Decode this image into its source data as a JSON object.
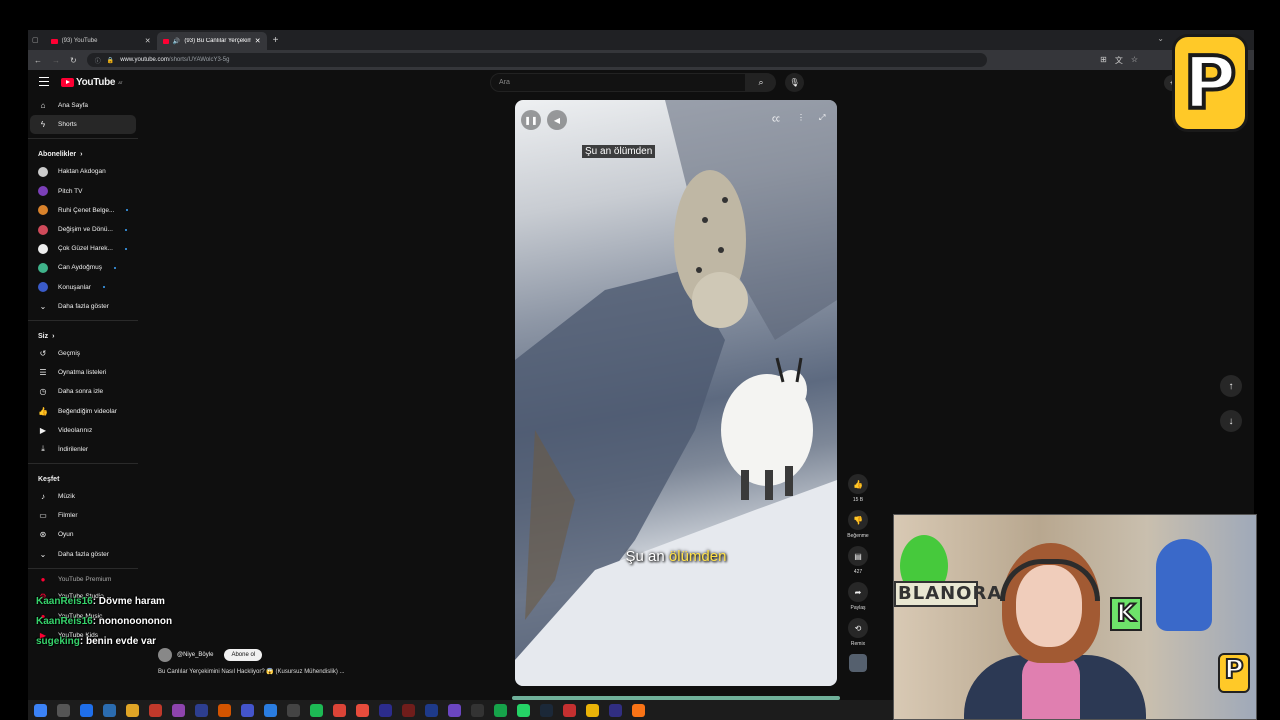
{
  "browser": {
    "tabs": [
      {
        "label": "(93) YouTube",
        "active": false
      },
      {
        "label": "(93) Bu Canlılar Yerçekimini",
        "active": true
      }
    ],
    "url": "www.youtube.com/shorts/UYAWolcY3-5g",
    "url_host": "www.youtube.com",
    "url_path": "/shorts/UYAWolcY3-5g"
  },
  "youtube": {
    "logo_text": "YouTube",
    "logo_suffix": "AT",
    "search_placeholder": "Ara",
    "create_label": "Ol"
  },
  "sidebar": {
    "main": [
      {
        "label": "Ana Sayfa",
        "icon": "home-icon"
      },
      {
        "label": "Shorts",
        "icon": "shorts-icon",
        "active": true
      }
    ],
    "subscriptions_header": "Abonelikler",
    "subscriptions": [
      {
        "label": "Haktan Akdogan",
        "color": "#cccccc",
        "dot": false
      },
      {
        "label": "Pitch TV",
        "color": "#7b3fb8",
        "dot": false
      },
      {
        "label": "Ruhi Çenet Belge...",
        "color": "#d9822b",
        "dot": true
      },
      {
        "label": "Değişim ve Dönü...",
        "color": "#d04a5a",
        "dot": true
      },
      {
        "label": "Çok Güzel Harek...",
        "color": "#eeeeee",
        "dot": true
      },
      {
        "label": "Can Aydoğmuş",
        "color": "#3fb38a",
        "dot": true
      },
      {
        "label": "Konuşanlar",
        "color": "#3a5bc9",
        "dot": true
      }
    ],
    "show_more_1": "Daha fazla göster",
    "you_header": "Siz",
    "you": [
      {
        "label": "Geçmiş",
        "icon": "history-icon"
      },
      {
        "label": "Oynatma listeleri",
        "icon": "playlist-icon"
      },
      {
        "label": "Daha sonra izle",
        "icon": "clock-icon"
      },
      {
        "label": "Beğendiğim videolar",
        "icon": "like-icon"
      },
      {
        "label": "Videolarınız",
        "icon": "video-icon"
      },
      {
        "label": "İndirilenler",
        "icon": "download-icon"
      }
    ],
    "explore_header": "Keşfet",
    "explore": [
      {
        "label": "Müzik",
        "icon": "music-icon"
      },
      {
        "label": "Filmler",
        "icon": "film-icon"
      },
      {
        "label": "Oyun",
        "icon": "game-icon"
      }
    ],
    "show_more_2": "Daha fazla göster",
    "more": [
      {
        "label": "YouTube Premium"
      },
      {
        "label": "YouTube Studio"
      },
      {
        "label": "YouTube Music"
      },
      {
        "label": "YouTube Kids"
      }
    ]
  },
  "player": {
    "caption_top": "Şu an ölümden",
    "caption_bottom_a": "Şu an ",
    "caption_bottom_b": "ölümden"
  },
  "actions": {
    "likes": "15 B",
    "dislike": "Beğenme",
    "comments": "427",
    "share": "Paylaş",
    "remix": "Remix"
  },
  "video": {
    "channel": "@Niye_Böyle",
    "subscribe": "Abone ol",
    "title": "Bu Canlılar Yerçekimini Nasıl Hackliyor? 😱 (Kusursuz Mühendislik) ..."
  },
  "chat": [
    {
      "name": "KaanReis16",
      "message": ": Dövme haram"
    },
    {
      "name": "KaanReis16",
      "message": ": nononoononon"
    },
    {
      "name": "sugeking",
      "message": ": benin evde var"
    }
  ],
  "webcam": {
    "sign_text": "BLANORA",
    "k_text": "K",
    "p_text": "P"
  },
  "overlay_logo": "P"
}
